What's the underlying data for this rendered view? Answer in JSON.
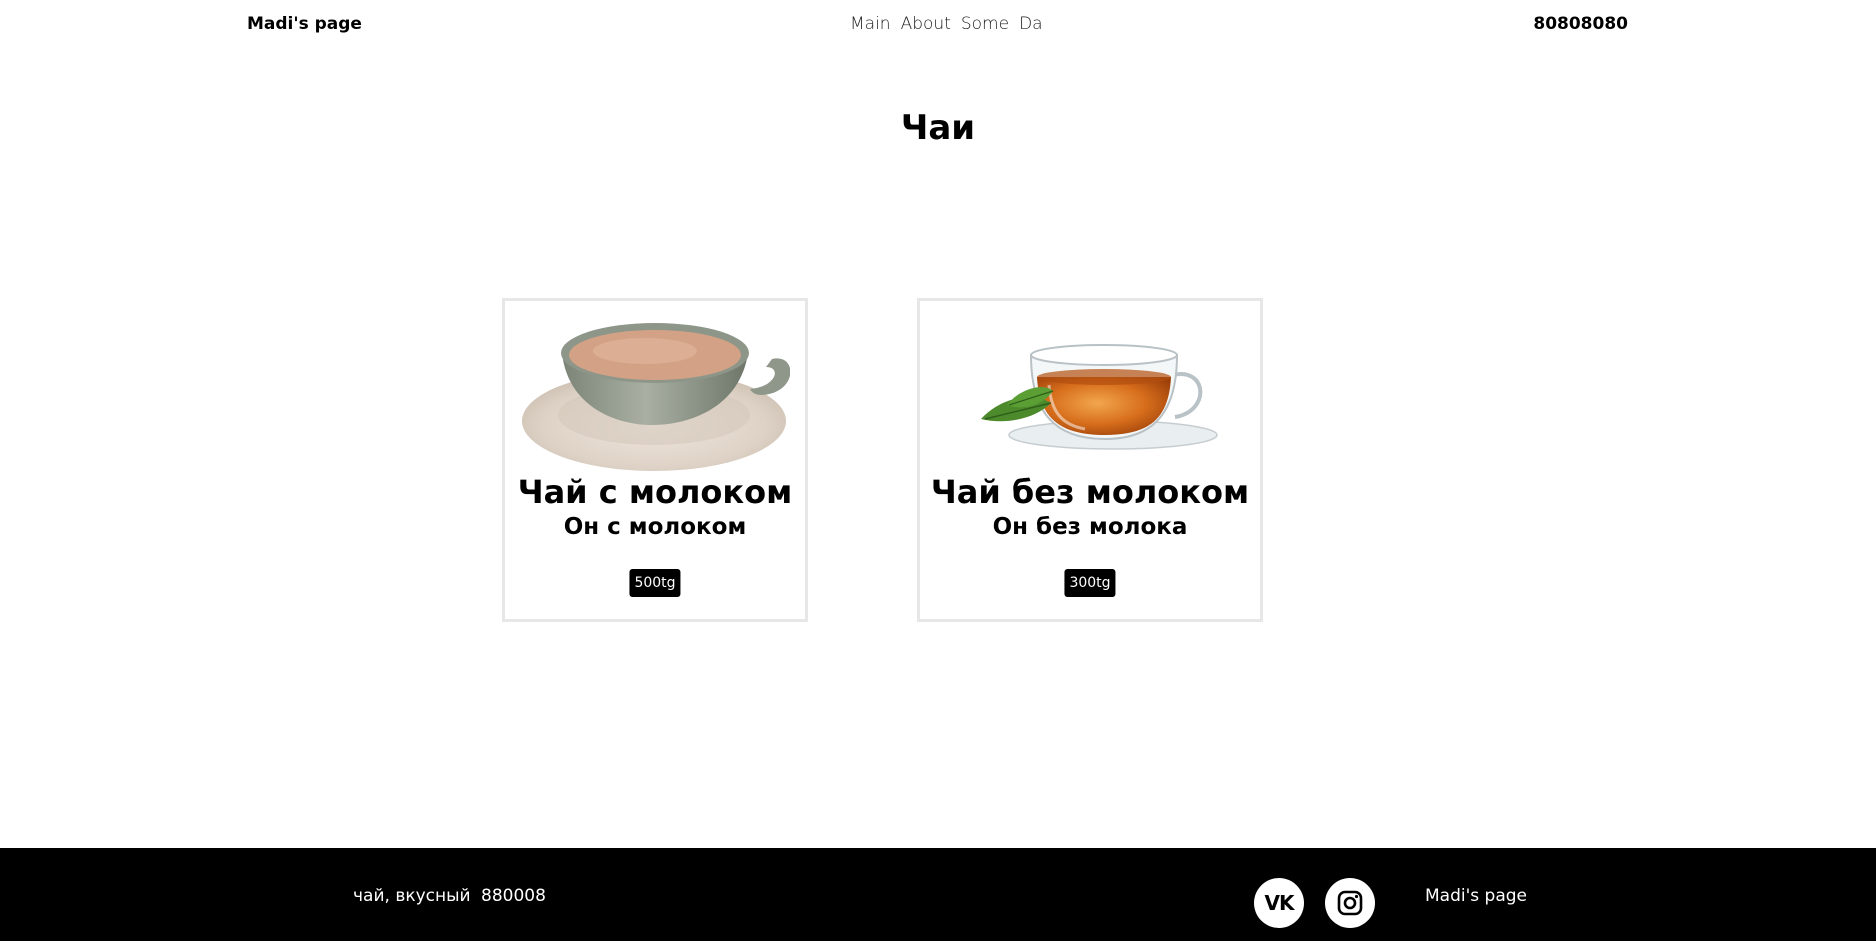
{
  "header": {
    "brand": "Madi's page",
    "nav": [
      "Main",
      "About",
      "Some",
      "Da"
    ],
    "phone": "80808080"
  },
  "main": {
    "title": "Чаи",
    "products": [
      {
        "name": "Чай с молоком",
        "subtitle": "Он с молоком",
        "price": "500tg",
        "image": "milk-tea-cup"
      },
      {
        "name": "Чай без молоком",
        "subtitle": "Он без молока",
        "price": "300tg",
        "image": "black-tea-glass-cup"
      }
    ]
  },
  "footer": {
    "tagline": "чай, вкусный",
    "code": "880008",
    "brand": "Madi's page",
    "social": [
      {
        "icon": "vk-icon"
      },
      {
        "icon": "instagram-icon"
      }
    ]
  },
  "colors": {
    "background": "#ffffff",
    "text": "#000000",
    "footer_background": "#000000",
    "card_border": "#e7e7e7",
    "badge_background": "#000000"
  }
}
